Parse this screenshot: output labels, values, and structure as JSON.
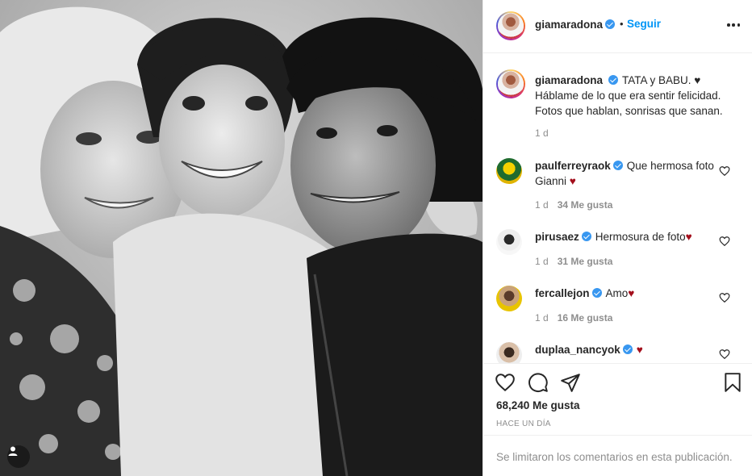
{
  "post": {
    "image_alt": "Black and white family photo",
    "user_tag_icon": "user-tag-icon"
  },
  "header": {
    "username": "giamaradona",
    "separator": "•",
    "follow_label": "Seguir",
    "more_icon": "more-options-icon"
  },
  "caption": {
    "username": "giamaradona",
    "text": "TATA y BABU. ♥ Háblame de lo que era sentir felicidad. Fotos que hablan, sonrisas que sanan.",
    "time": "1 d"
  },
  "comments": [
    {
      "username": "paulferreyraok",
      "text": "Que hermosa foto Gianni",
      "emoji": "♥",
      "time": "1 d",
      "likes": "34 Me gusta"
    },
    {
      "username": "pirusaez",
      "text": "Hermosura de foto",
      "emoji": "♥",
      "time": "1 d",
      "likes": "31 Me gusta"
    },
    {
      "username": "fercallejon",
      "text": "Amo",
      "emoji": "♥",
      "time": "1 d",
      "likes": "16 Me gusta"
    },
    {
      "username": "duplaa_nancyok",
      "text": "",
      "emoji": "♥"
    }
  ],
  "actions": {
    "like_icon": "heart-icon",
    "comment_icon": "comment-icon",
    "share_icon": "share-icon",
    "save_icon": "bookmark-icon",
    "likes_count": "68,240 Me gusta",
    "posted_time": "HACE UN DÍA"
  },
  "footer": {
    "comments_limited": "Se limitaron los comentarios en esta publicación."
  },
  "colors": {
    "link_blue": "#0095f6",
    "verified_blue": "#3897f0",
    "muted_gray": "#8e8e8e",
    "heart_red": "#a30f1c",
    "border": "#efefef"
  }
}
